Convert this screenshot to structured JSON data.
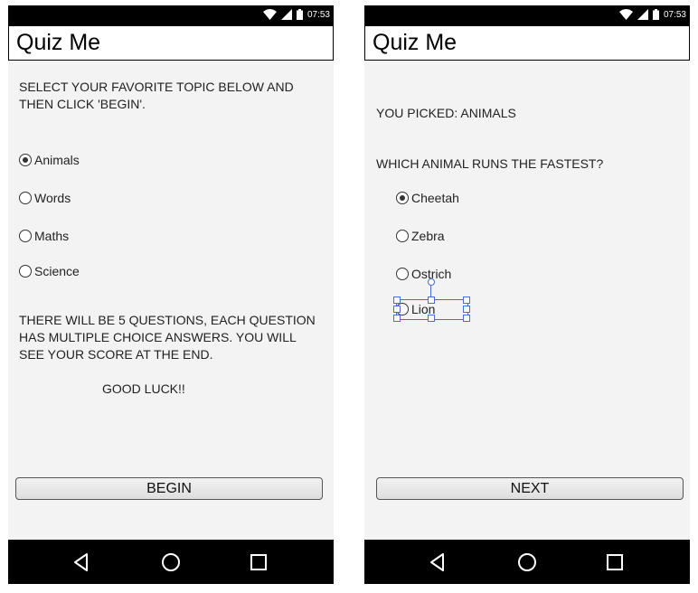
{
  "status_bar": {
    "time": "07:53"
  },
  "app": {
    "title": "Quiz Me"
  },
  "screen_topic": {
    "instruction": "SELECT YOUR FAVORITE TOPIC BELOW AND THEN CLICK 'BEGIN'.",
    "options": [
      {
        "label": "Animals",
        "checked": true
      },
      {
        "label": "Words",
        "checked": false
      },
      {
        "label": "Maths",
        "checked": false
      },
      {
        "label": "Science",
        "checked": false
      }
    ],
    "info": "THERE WILL BE 5 QUESTIONS, EACH QUESTION HAS MULTIPLE CHOICE ANSWERS. YOU WILL SEE YOUR SCORE AT THE END.",
    "good_luck": "GOOD LUCK!!",
    "begin_label": "BEGIN"
  },
  "screen_question": {
    "picked": "YOU PICKED: ANIMALS",
    "question": "WHICH ANIMAL RUNS THE FASTEST?",
    "options": [
      {
        "label": "Cheetah",
        "checked": true
      },
      {
        "label": "Zebra",
        "checked": false
      },
      {
        "label": "Ostrich",
        "checked": false
      },
      {
        "label": "Lion",
        "checked": false
      }
    ],
    "next_label": "NEXT"
  },
  "icons": {
    "wifi": "wifi-icon",
    "signal": "cell-signal-icon",
    "battery": "battery-icon",
    "back": "back-triangle-icon",
    "home": "home-circle-icon",
    "recents": "recents-square-icon"
  },
  "colors": {
    "screen_bg": "#f3f3f3",
    "selection": "#4a6ed6"
  }
}
